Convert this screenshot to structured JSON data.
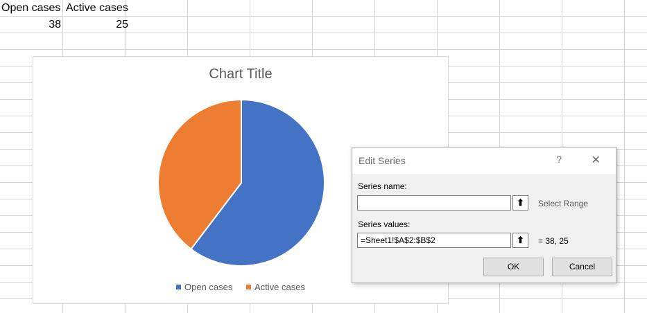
{
  "sheet": {
    "headers": [
      "Open cases",
      "Active cases"
    ],
    "values": [
      "38",
      "25"
    ]
  },
  "chart_data": {
    "type": "pie",
    "title": "Chart Title",
    "categories": [
      "Open cases",
      "Active cases"
    ],
    "values": [
      38,
      25
    ],
    "colors": [
      "#4472c4",
      "#ed7d31"
    ],
    "legend": "bottom"
  },
  "dialog": {
    "title": "Edit Series",
    "help": "?",
    "close": "✕",
    "series_name_label": "Series name:",
    "series_name_value": "",
    "select_range_text": "Select Range",
    "series_values_label": "Series values:",
    "series_values_value": "=Sheet1!$A$2:$B$2",
    "values_preview": "= 38, 25",
    "collapse_icon": "⬆",
    "ok_label": "OK",
    "cancel_label": "Cancel"
  }
}
